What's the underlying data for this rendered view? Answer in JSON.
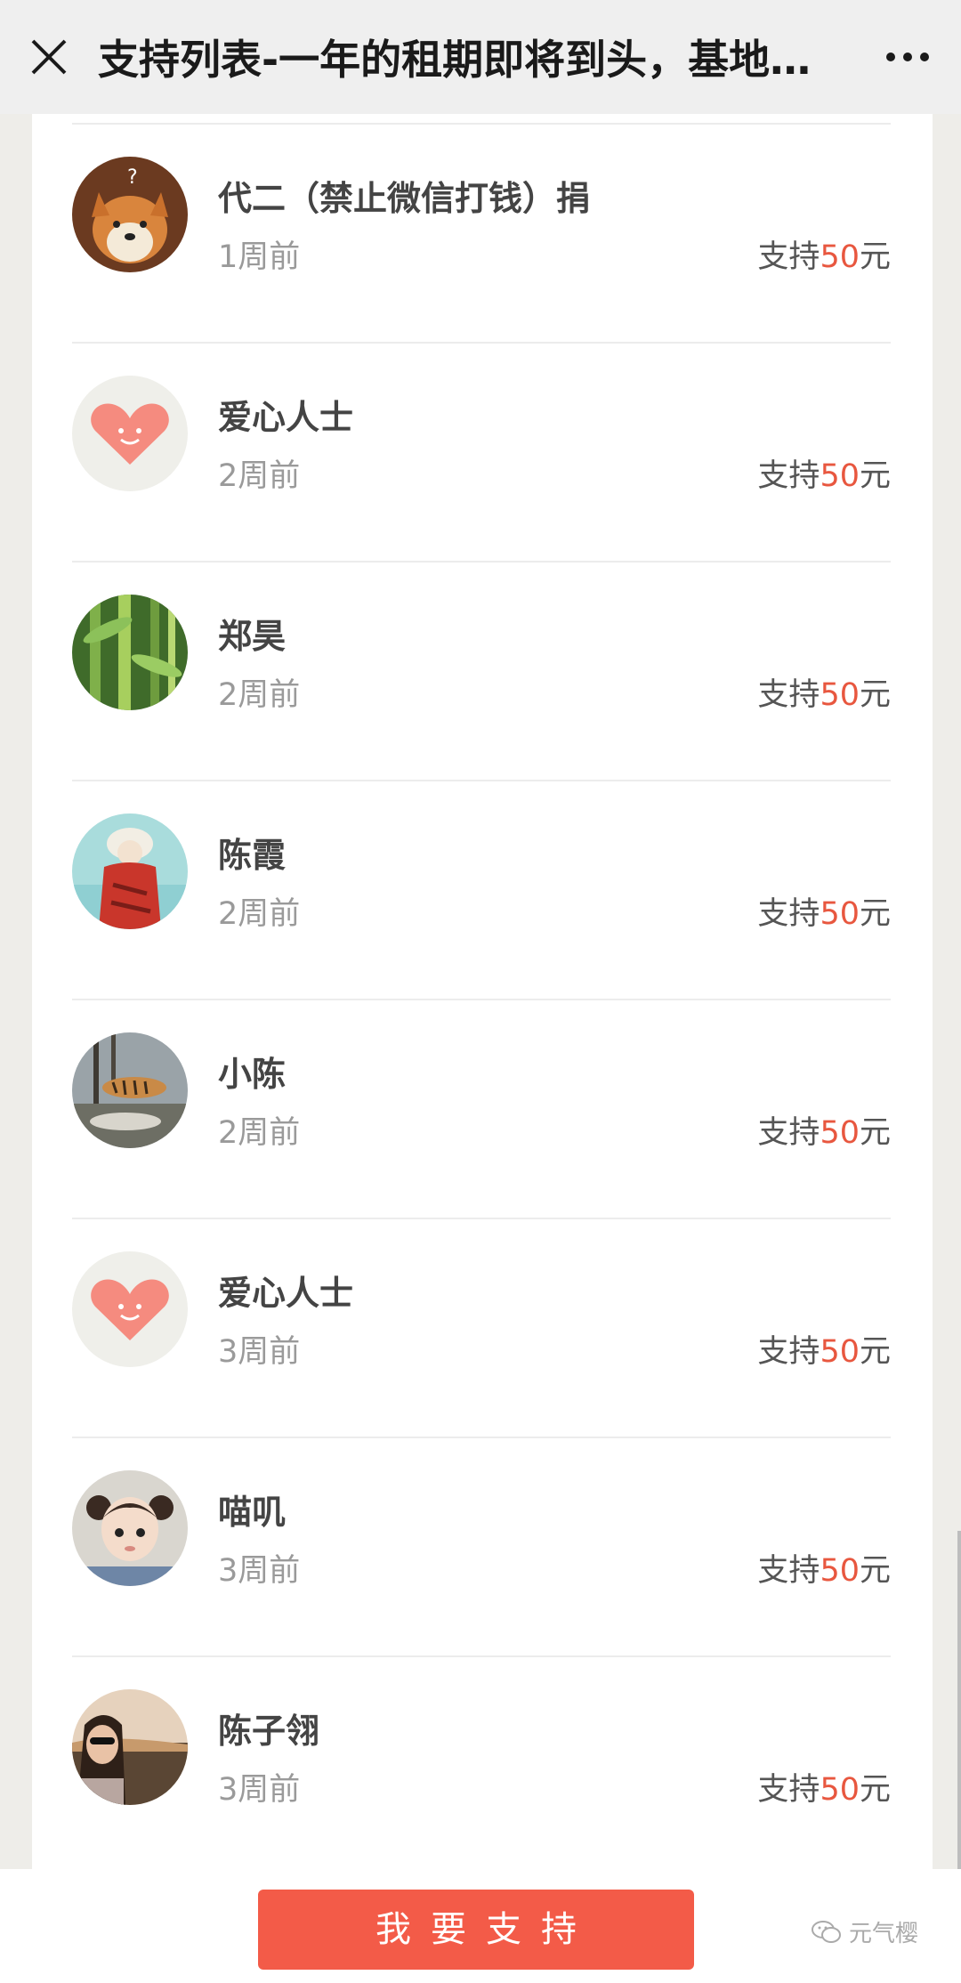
{
  "header": {
    "title": "支持列表-一年的租期即将到头，基地四..."
  },
  "supporters": [
    {
      "name": "代二（禁止微信打钱）捐",
      "time": "1周前",
      "amount_prefix": "支持",
      "amount": "50",
      "amount_suffix": "元",
      "avatar": "shiba-dog-avatar"
    },
    {
      "name": "爱心人士",
      "time": "2周前",
      "amount_prefix": "支持",
      "amount": "50",
      "amount_suffix": "元",
      "avatar": "heart-avatar"
    },
    {
      "name": "郑昊",
      "time": "2周前",
      "amount_prefix": "支持",
      "amount": "50",
      "amount_suffix": "元",
      "avatar": "bamboo-avatar"
    },
    {
      "name": "陈霞",
      "time": "2周前",
      "amount_prefix": "支持",
      "amount": "50",
      "amount_suffix": "元",
      "avatar": "scarf-woman-avatar"
    },
    {
      "name": "小陈",
      "time": "2周前",
      "amount_prefix": "支持",
      "amount": "50",
      "amount_suffix": "元",
      "avatar": "tiger-avatar"
    },
    {
      "name": "爱心人士",
      "time": "3周前",
      "amount_prefix": "支持",
      "amount": "50",
      "amount_suffix": "元",
      "avatar": "heart-avatar"
    },
    {
      "name": "喵叽",
      "time": "3周前",
      "amount_prefix": "支持",
      "amount": "50",
      "amount_suffix": "元",
      "avatar": "child-avatar"
    },
    {
      "name": "陈子翎",
      "time": "3周前",
      "amount_prefix": "支持",
      "amount": "50",
      "amount_suffix": "元",
      "avatar": "sunglasses-woman-avatar"
    }
  ],
  "footer": {
    "support_button": "我要支持",
    "watermark": "元气樱"
  },
  "colors": {
    "accent": "#f35b48",
    "amount": "#e8573f"
  }
}
